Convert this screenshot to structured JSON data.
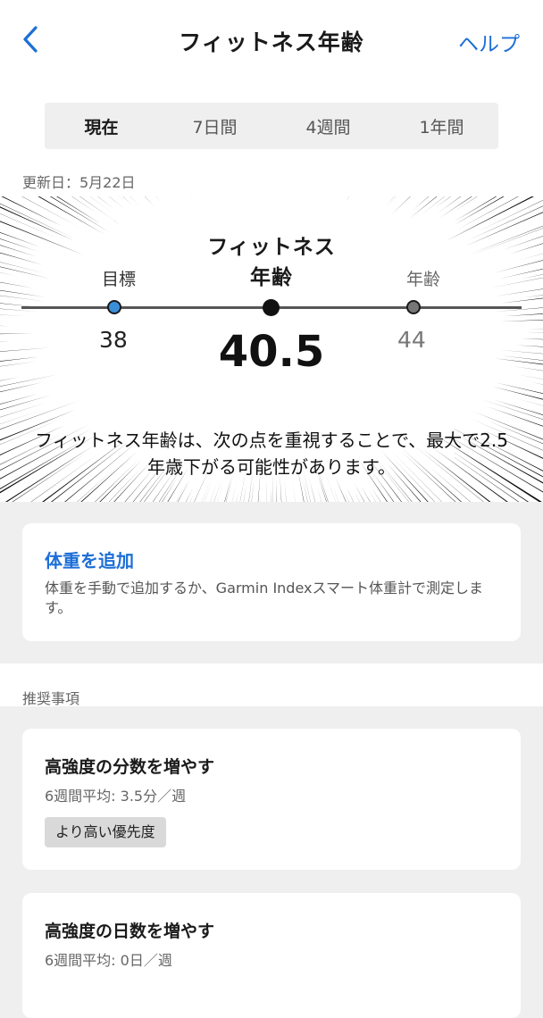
{
  "header": {
    "title": "フィットネス年齢",
    "help": "ヘルプ"
  },
  "tabs": [
    {
      "label": "現在",
      "active": true
    },
    {
      "label": "7日間",
      "active": false
    },
    {
      "label": "4週間",
      "active": false
    },
    {
      "label": "1年間",
      "active": false
    }
  ],
  "updated": "更新日：5月22日",
  "hero": {
    "title_line1": "フィットネス",
    "title_line2": "年齢",
    "target_label": "目標",
    "target_value": "38",
    "fitness_age": "40.5",
    "age_label": "年齢",
    "age_value": "44",
    "message": "フィットネス年齢は、次の点を重視することで、最大で2.5年歳下がる可能性があります。"
  },
  "weight_card": {
    "link": "体重を追加",
    "description": "体重を手動で追加するか、Garmin Indexスマート体重計で測定します。"
  },
  "recommendations": {
    "heading": "推奨事項",
    "items": [
      {
        "title": "高強度の分数を増やす",
        "subtitle": "6週間平均: 3.5分／週",
        "badge": "より高い優先度"
      },
      {
        "title": "高強度の日数を増やす",
        "subtitle": "6週間平均: 0日／週"
      }
    ]
  },
  "colors": {
    "accent": "#1d6fd6",
    "target_dot": "#3b8fd9",
    "background": "#efefef"
  },
  "icons": {
    "back": "chevron-left-icon"
  }
}
